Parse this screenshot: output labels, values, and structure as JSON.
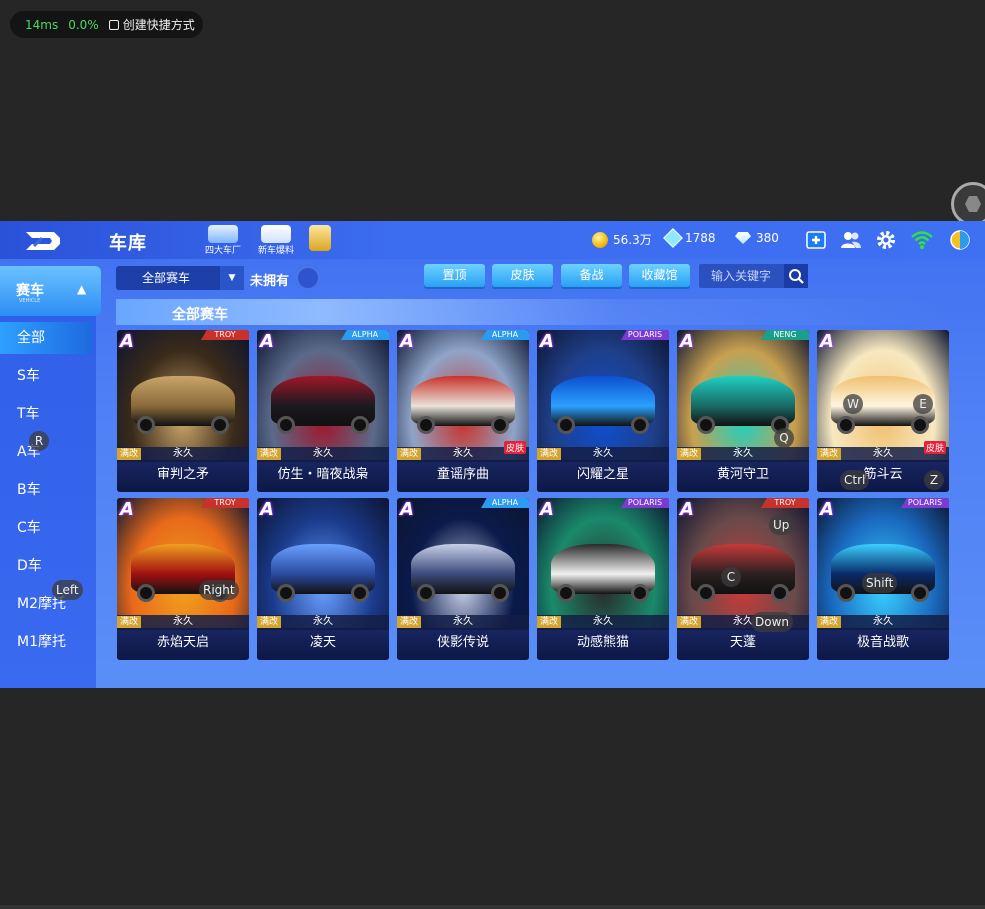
{
  "overlay": {
    "latency": "14ms",
    "loss": "0.0%",
    "shortcut_label": "创建快捷方式"
  },
  "header": {
    "title": "车库",
    "icons": [
      {
        "label": "四大车厂",
        "icon": "car-factory-icon"
      },
      {
        "label": "新车爆料",
        "icon": "new-car-icon"
      },
      {
        "label": "",
        "icon": "gift-icon"
      }
    ],
    "coins": "56.3万",
    "tokens": "1788",
    "diamonds": "380"
  },
  "sidebar": {
    "header": "赛车",
    "header_sub": "VEHICLE",
    "items": [
      {
        "label": "全部",
        "active": true
      },
      {
        "label": "S车"
      },
      {
        "label": "T车"
      },
      {
        "label": "A车"
      },
      {
        "label": "B车"
      },
      {
        "label": "C车"
      },
      {
        "label": "D车"
      },
      {
        "label": "M2摩托"
      },
      {
        "label": "M1摩托"
      }
    ]
  },
  "filters": {
    "dropdown_value": "全部赛车",
    "not_owned": "未拥有",
    "buttons": [
      "置顶",
      "皮肤",
      "备战",
      "收藏馆"
    ],
    "search_placeholder": "输入关键字"
  },
  "section_title": "全部赛车",
  "cards": [
    {
      "grade": "A",
      "brand": "TROY",
      "name": "审判之矛",
      "mod": "满改",
      "duration": "永久",
      "skin": "",
      "colors": [
        "#3a2a1a",
        "#8a6a3a",
        "#c9a56a"
      ],
      "brand_color": "#c8322a"
    },
    {
      "grade": "A",
      "brand": "ALPHA",
      "name": "仿生・暗夜战枭",
      "mod": "满改",
      "duration": "永久",
      "skin": "",
      "colors": [
        "#5b6a8a",
        "#1a1a1f",
        "#a0162a"
      ],
      "brand_color": "#2a9bf0"
    },
    {
      "grade": "A",
      "brand": "ALPHA",
      "name": "童谣序曲",
      "mod": "满改",
      "duration": "永久",
      "skin": "皮肤",
      "colors": [
        "#8fa4c8",
        "#e8e2da",
        "#c8322a"
      ],
      "brand_color": "#2a9bf0"
    },
    {
      "grade": "A",
      "brand": "POLARIS",
      "name": "闪耀之星",
      "mod": "满改",
      "duration": "永久",
      "skin": "",
      "colors": [
        "#1f3f8a",
        "#2aa0ff",
        "#0d4fd0"
      ],
      "brand_color": "#7b3bd1"
    },
    {
      "grade": "A",
      "brand": "NENG",
      "name": "黄河守卫",
      "mod": "满改",
      "duration": "永久",
      "skin": "",
      "colors": [
        "#c8a050",
        "#1a6a66",
        "#1fd0c0"
      ],
      "brand_color": "#1aa08a"
    },
    {
      "grade": "A",
      "brand": "",
      "name": "筋斗云",
      "mod": "满改",
      "duration": "永久",
      "skin": "皮肤",
      "colors": [
        "#f7e8c0",
        "#fff5e0",
        "#f0c070"
      ],
      "brand_color": "#ffffff"
    },
    {
      "grade": "A",
      "brand": "TROY",
      "name": "赤焰天启",
      "mod": "满改",
      "duration": "永久",
      "skin": "",
      "colors": [
        "#e86a1a",
        "#a01010",
        "#f0a020"
      ],
      "brand_color": "#c8322a"
    },
    {
      "grade": "A",
      "brand": "",
      "name": "凌天",
      "mod": "满改",
      "duration": "永久",
      "skin": "",
      "colors": [
        "#1a3a8a",
        "#2a4aa0",
        "#6aa0ff"
      ],
      "brand_color": "#2a9bf0"
    },
    {
      "grade": "A",
      "brand": "ALPHA",
      "name": "侠影传说",
      "mod": "满改",
      "duration": "永久",
      "skin": "",
      "colors": [
        "#0a1a4a",
        "#3a4a7a",
        "#c8d0e8"
      ],
      "brand_color": "#2a9bf0"
    },
    {
      "grade": "A",
      "brand": "POLARIS",
      "name": "动感熊猫",
      "mod": "满改",
      "duration": "永久",
      "skin": "",
      "colors": [
        "#1a8a6a",
        "#f0f0f0",
        "#2a2a2a"
      ],
      "brand_color": "#7b3bd1"
    },
    {
      "grade": "A",
      "brand": "TROY",
      "name": "天蓬",
      "mod": "满改",
      "duration": "永久",
      "skin": "",
      "colors": [
        "#6a4a4a",
        "#2a2020",
        "#c83a3a"
      ],
      "brand_color": "#c8322a"
    },
    {
      "grade": "A",
      "brand": "POLARIS",
      "name": "极音战歌",
      "mod": "满改",
      "duration": "永久",
      "skin": "",
      "colors": [
        "#1a6ac0",
        "#0a2a6a",
        "#3ad0ff"
      ],
      "brand_color": "#7b3bd1"
    }
  ],
  "key_overlays": [
    "R",
    "Left",
    "W",
    "E",
    "Q",
    "Ctrl",
    "Z",
    "Right",
    "Up",
    "C",
    "Down",
    "Shift"
  ]
}
